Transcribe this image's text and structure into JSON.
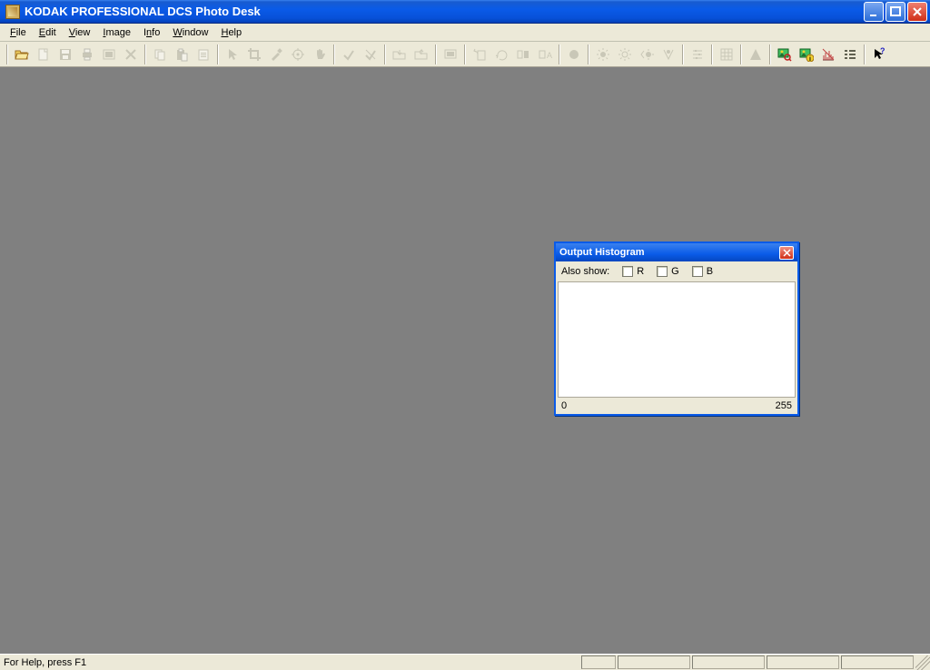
{
  "app": {
    "title": "KODAK PROFESSIONAL DCS Photo Desk"
  },
  "menu": {
    "items": [
      "File",
      "Edit",
      "View",
      "Image",
      "Info",
      "Window",
      "Help"
    ]
  },
  "toolbar": {
    "groups": [
      [
        "open",
        "new",
        "save",
        "print",
        "page-setup",
        "delete"
      ],
      [
        "copy",
        "paste",
        "clipboard"
      ],
      [
        "pointer",
        "crop",
        "eyedropper",
        "target",
        "hand"
      ],
      [
        "check-accept",
        "check-reject"
      ],
      [
        "folder-in",
        "folder-out"
      ],
      [
        "screen"
      ],
      [
        "rotate-left",
        "rotate-right",
        "flip-h",
        "text-tool"
      ],
      [
        "record"
      ],
      [
        "sun-plus",
        "sun-minus",
        "sun-left",
        "sun-right"
      ],
      [
        "levels"
      ],
      [
        "grid-tool"
      ],
      [
        "warning"
      ],
      [
        "find-image",
        "image-info",
        "histogram-tool",
        "list-tool"
      ],
      [
        "context-help"
      ]
    ]
  },
  "histogram": {
    "title": "Output Histogram",
    "also_show": "Also show:",
    "r": "R",
    "g": "G",
    "b": "B",
    "min": "0",
    "max": "255"
  },
  "status": {
    "text": "For Help, press F1"
  }
}
